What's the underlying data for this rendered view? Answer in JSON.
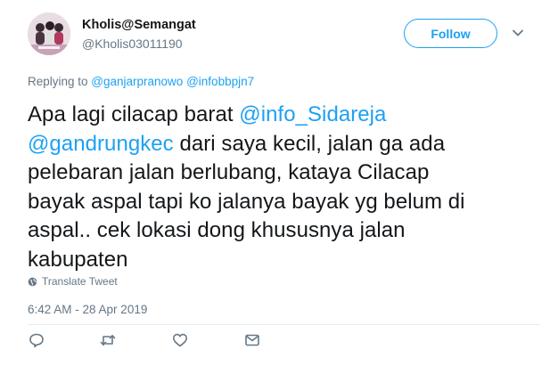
{
  "user": {
    "display_name": "Kholis@Semangat",
    "handle": "@Kholis03011190"
  },
  "header": {
    "follow_label": "Follow",
    "caret_icon": "chevron-down-icon"
  },
  "replying": {
    "prefix": "Replying to ",
    "mentions": [
      "@ganjarpranowo",
      "@infobbpjn7"
    ]
  },
  "tweet": {
    "lines": [
      [
        {
          "t": "Apa lagi cilacap barat "
        },
        {
          "t": "@info_Sidareja",
          "link": true
        }
      ],
      [
        {
          "t": "@gandrungkec",
          "link": true
        },
        {
          "t": " dari saya kecil, jalan ga ada"
        }
      ],
      [
        {
          "t": "pelebaran jalan berlubang, kataya Cilacap"
        }
      ],
      [
        {
          "t": "bayak aspal tapi ko jalanya bayak yg belum di"
        }
      ],
      [
        {
          "t": "aspal.. cek lokasi dong khususnya jalan"
        }
      ],
      [
        {
          "t": "kabupaten"
        }
      ]
    ],
    "translate_label": "Translate Tweet",
    "timestamp": "6:42 AM - 28 Apr 2019"
  },
  "actions": [
    {
      "name": "reply-icon"
    },
    {
      "name": "retweet-icon"
    },
    {
      "name": "like-icon"
    },
    {
      "name": "direct-message-icon"
    }
  ],
  "colors": {
    "link": "#1da1f2",
    "secondary_text": "#657786",
    "primary_text": "#14171a"
  }
}
